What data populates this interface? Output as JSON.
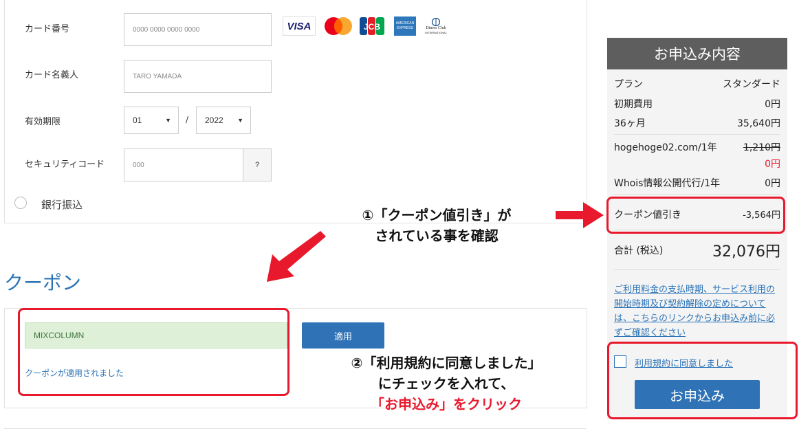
{
  "payment": {
    "card_number_label": "カード番号",
    "card_number_placeholder": "0000 0000 0000 0000",
    "card_holder_label": "カード名義人",
    "card_holder_placeholder": "TARO YAMADA",
    "expiry_label": "有効期限",
    "expiry_month": "01",
    "expiry_year": "2022",
    "expiry_separator": "/",
    "security_label": "セキュリティコード",
    "security_placeholder": "000",
    "security_help": "?",
    "bank_transfer_label": "銀行振込",
    "card_brands": {
      "visa": "VISA",
      "jcb": "JCB",
      "amex_line1": "AMERICAN",
      "amex_line2": "EXPRESS",
      "diners_line1": "Diners Club",
      "diners_line2": "INTERNATIONAL"
    }
  },
  "coupon": {
    "title": "クーポン",
    "code": "MIXCOLUMN",
    "apply_label": "適用",
    "applied_message": "クーポンが適用されました"
  },
  "annotations": {
    "step1_line1": "①「クーポン値引き」が",
    "step1_line2": "されている事を確認",
    "step2_line1": "②「利用規約に同意しました」",
    "step2_line2": "にチェックを入れて、",
    "step2_line3": "「お申込み」をクリック",
    "highlight_color": "#e8192c"
  },
  "summary": {
    "title": "お申込み内容",
    "plan_label": "プラン",
    "plan_value": "スタンダード",
    "initial_label": "初期費用",
    "initial_value": "0円",
    "months_label": "36ヶ月",
    "months_value": "35,640円",
    "domain_label": "hogehoge02.com/1年",
    "domain_original": "1,210円",
    "domain_value": "0円",
    "whois_label": "Whois情報公開代行/1年",
    "whois_value": "0円",
    "coupon_label": "クーポン値引き",
    "coupon_value": "-3,564円",
    "total_label": "合計 (税込)",
    "total_value": "32,076円",
    "notice": "ご利用料金の支払時期、サービス利用の開始時期及び契約解除の定めについては、こちらのリンクからお申込み前に必ずご確認ください",
    "agree_label": "利用規約に同意しました",
    "submit_label": "お申込み"
  },
  "colors": {
    "accent": "#2f73b6",
    "link": "#2a73b7",
    "header_bg": "#5e5e5e",
    "success_bg": "#dff0d8"
  }
}
